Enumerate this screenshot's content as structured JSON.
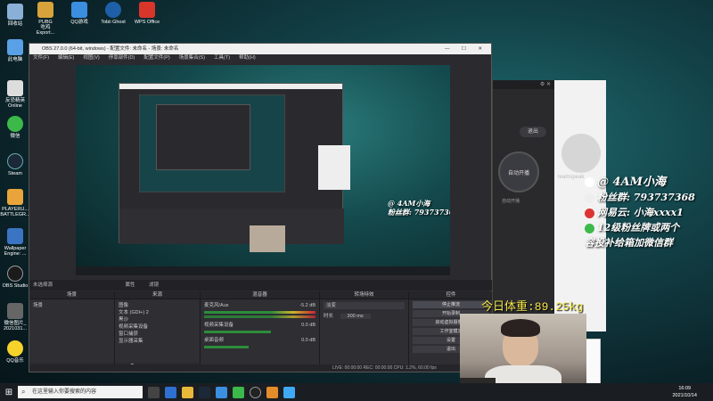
{
  "desktop_icons": [
    {
      "label": "回收站",
      "color": "#8ab0d8"
    },
    {
      "label": "此电脑",
      "color": "#5aa0e6"
    },
    {
      "label": "反恐精英\nOnline",
      "color": "#ddd"
    },
    {
      "label": "微信",
      "color": "#3cb94a"
    },
    {
      "label": "Steam",
      "color": "#1b2838"
    },
    {
      "label": "PLAYERU...\nBATTLEGR...",
      "color": "#e9a53b"
    },
    {
      "label": "Wallpaper\nEngine: ...",
      "color": "#3b74c2"
    },
    {
      "label": "OBS Studio",
      "color": "#1b1b1b"
    },
    {
      "label": "微信图片_\n2021031...",
      "color": "#666"
    },
    {
      "label": "QQ音乐",
      "color": "#f7d22b"
    }
  ],
  "top_icons": [
    {
      "label": "PUBG\n吃鸡\nExport...",
      "color": "#d7a33a"
    },
    {
      "label": "QQ游戏",
      "color": "#3b8ee0"
    },
    {
      "label": "Tobii Ghost",
      "color": "#1e5fa8"
    },
    {
      "label": "WPS Office",
      "color": "#d9362b"
    }
  ],
  "obs": {
    "title": "OBS 27.0.0 (64-bit, windows) - 配置文件: 未命名 - 场景: 未命名",
    "menu": [
      "文件(F)",
      "编辑(E)",
      "视图(V)",
      "停靠部件(D)",
      "配置文件(P)",
      "场景集合(S)",
      "工具(T)",
      "帮助(H)"
    ],
    "scene_bar_label": "未选择源",
    "scene_bar_props": "属性",
    "scene_bar_filters": "滤镜",
    "docks": {
      "scenes": {
        "title": "场景",
        "items": [
          "场景"
        ]
      },
      "sources": {
        "title": "来源",
        "items": [
          "图像",
          "文本 (GDI+) 2",
          "黑沙",
          "视频采集设备",
          "窗口捕获",
          "显示器采集"
        ]
      },
      "mixer": {
        "title": "混音器",
        "channels": [
          {
            "name": "麦克风/Aux",
            "db": "-5.2 dB"
          },
          {
            "name": "视频采集设备",
            "db": "0.0 dB"
          },
          {
            "name": "桌面音频",
            "db": "0.0 dB"
          }
        ]
      },
      "transitions": {
        "title": "转场特效",
        "type": "淡变",
        "duration_label": "时长",
        "duration": "300 ms"
      },
      "controls": {
        "title": "控件",
        "buttons": [
          "停止推流",
          "开始录制",
          "启动虚拟摄像机",
          "工作室模式",
          "设置",
          "退出"
        ]
      }
    },
    "status": "LIVE: 00:00:00   REC: 00:00:00   CPU: 1.2%, 60.00 fps"
  },
  "overlay": {
    "streamer": "@ 4AM小海",
    "fan_group": "粉丝群: 793737368",
    "netease": "网易云: 小海xxxx1",
    "line4": "12级粉丝牌或两个",
    "line5": "容投补给箱加微信群"
  },
  "weight_label": "今日体重:89.25kg",
  "dark_window": {
    "btn1": "退出",
    "btn2": "自动开播",
    "btn3": "自动开播"
  },
  "white_window": {
    "logo_text": "teamspeak"
  },
  "taskbar": {
    "search_placeholder": "在这里输入你要搜索的内容",
    "time": "16:09",
    "date": "2021/10/14"
  },
  "colors": {
    "obs_bg": "#2b2b2f",
    "accent_yellow": "#f5e84a",
    "desktop_teal": "#124147"
  }
}
